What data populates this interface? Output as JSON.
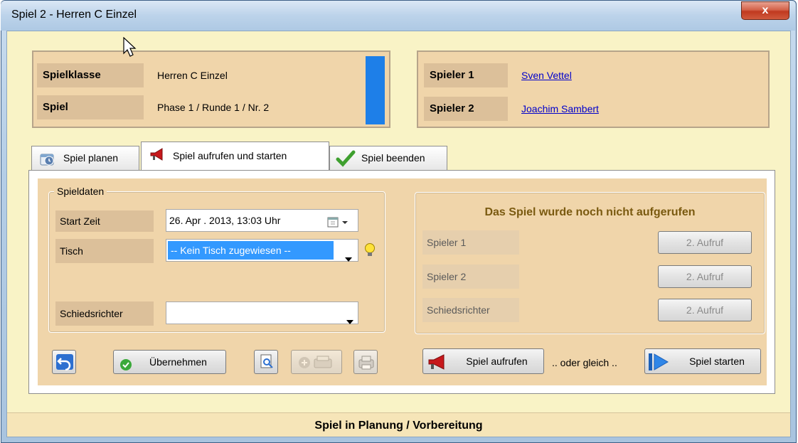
{
  "window": {
    "title": "Spiel 2 - Herren C Einzel",
    "close_glyph": "x"
  },
  "match_info": {
    "spielklasse_label": "Spielklasse",
    "spielklasse_value": "Herren C Einzel",
    "spiel_label": "Spiel",
    "spiel_value": "Phase 1 / Runde 1 / Nr. 2"
  },
  "players": {
    "spieler1_label": "Spieler 1",
    "spieler1_name": "Sven Vettel",
    "spieler2_label": "Spieler 2",
    "spieler2_name": "Joachim Sambert"
  },
  "tabs": [
    {
      "label": "Spiel planen",
      "icon": "calendar-icon"
    },
    {
      "label": "Spiel aufrufen und starten",
      "icon": "megaphone-icon"
    },
    {
      "label": "Spiel beenden",
      "icon": "checkmark-icon"
    }
  ],
  "spieldaten": {
    "legend": "Spieldaten",
    "start_label": "Start Zeit",
    "start_value": "26. Apr . 2013, 13:03 Uhr",
    "tisch_label": "Tisch",
    "tisch_value": "-- Kein Tisch zugewiesen --",
    "schiedsrichter_label": "Schiedsrichter",
    "schiedsrichter_value": ""
  },
  "aufruf": {
    "status": "Das Spiel wurde noch nicht aufgerufen",
    "rows": [
      {
        "label": "Spieler 1",
        "button": "2. Aufruf"
      },
      {
        "label": "Spieler 2",
        "button": "2. Aufruf"
      },
      {
        "label": "Schiedsrichter",
        "button": "2. Aufruf"
      }
    ]
  },
  "actions": {
    "uebernehmen": "Übernehmen",
    "spiel_aufrufen": "Spiel aufrufen",
    "oder_gleich": ".. oder gleich ..",
    "spiel_starten": "Spiel starten"
  },
  "statusbar": {
    "text": "Spiel in Planung / Vorbereitung"
  },
  "colors": {
    "panel": "#f0d5aa",
    "label_bg": "#dcc09a",
    "client_bg": "#f9f3c6",
    "accent_blue": "#1e7fe8",
    "status_text": "#7a5a10"
  }
}
